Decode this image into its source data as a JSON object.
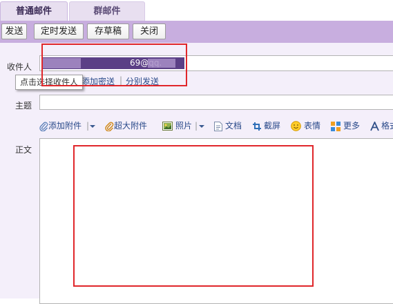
{
  "tabs": [
    {
      "label": "普通邮件"
    },
    {
      "label": "群邮件"
    }
  ],
  "toolbar": {
    "send": "发送",
    "scheduled_send": "定时发送",
    "save_draft": "存草稿",
    "close": "关闭"
  },
  "recipient": {
    "label": "收件人",
    "value": "69@qq.",
    "suffix": ";",
    "tooltip": "点击选择收件人",
    "add_bcc": "添加密送",
    "separator": "|",
    "separate_send": "分别发送"
  },
  "subject": {
    "label": "主题",
    "value": ""
  },
  "attachments": {
    "add_attachment": "添加附件",
    "large_attachment": "超大附件",
    "photo": "照片",
    "document": "文档",
    "screenshot": "截屏",
    "emoji": "表情",
    "more": "更多",
    "format": "格式"
  },
  "body": {
    "label": "正文",
    "value": ""
  },
  "colors": {
    "accent": "#c8aedf",
    "highlight": "#e0262a",
    "chip": "#5b3f86"
  }
}
